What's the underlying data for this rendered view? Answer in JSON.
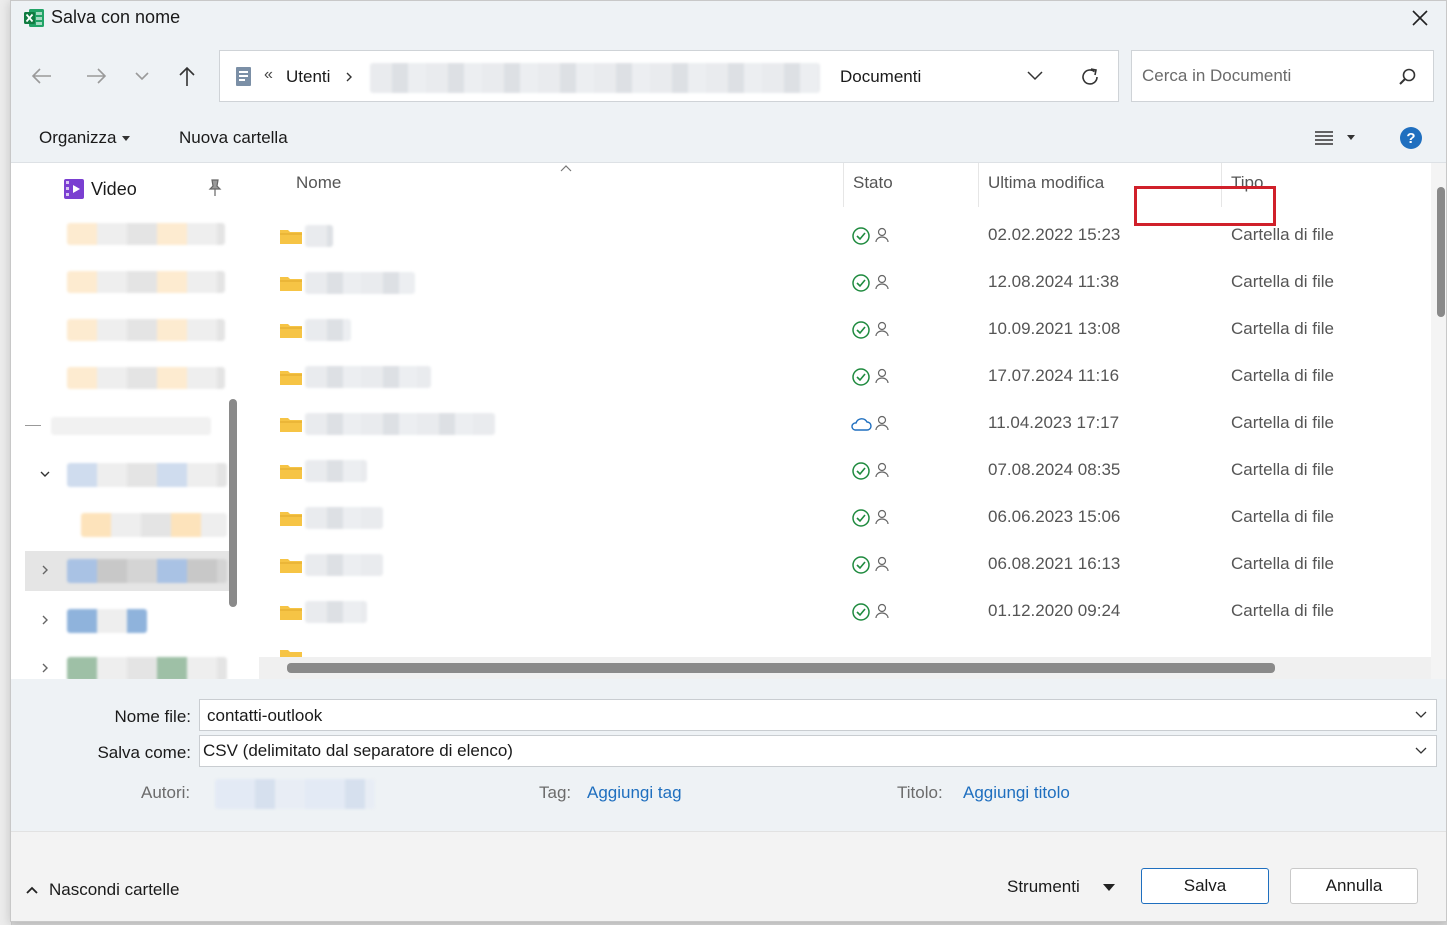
{
  "window": {
    "title": "Salva con nome"
  },
  "address": {
    "overflow": "«",
    "crumb_users": "Utenti",
    "crumb_current": "Documenti"
  },
  "search": {
    "placeholder": "Cerca in Documenti"
  },
  "toolbar": {
    "organize": "Organizza",
    "new_folder": "Nuova cartella"
  },
  "sidebar": {
    "items": [
      {
        "label": "Video"
      }
    ]
  },
  "columns": {
    "name": "Nome",
    "status": "Stato",
    "modified": "Ultima modifica",
    "type": "Tipo"
  },
  "files": [
    {
      "status": "synced",
      "modified": "02.02.2022 15:23",
      "type": "Cartella di file"
    },
    {
      "status": "synced",
      "modified": "12.08.2024 11:38",
      "type": "Cartella di file"
    },
    {
      "status": "synced",
      "modified": "10.09.2021 13:08",
      "type": "Cartella di file"
    },
    {
      "status": "synced",
      "modified": "17.07.2024 11:16",
      "type": "Cartella di file"
    },
    {
      "status": "cloud",
      "modified": "11.04.2023 17:17",
      "type": "Cartella di file"
    },
    {
      "status": "synced",
      "modified": "07.08.2024 08:35",
      "type": "Cartella di file"
    },
    {
      "status": "synced",
      "modified": "06.06.2023 15:06",
      "type": "Cartella di file"
    },
    {
      "status": "synced",
      "modified": "06.08.2021 16:13",
      "type": "Cartella di file"
    },
    {
      "status": "synced",
      "modified": "01.12.2020 09:24",
      "type": "Cartella di file"
    }
  ],
  "form": {
    "filename_label": "Nome file:",
    "filename_value": "contatti-outlook",
    "savetype_label": "Salva come:",
    "savetype_value": "CSV (delimitato dal separatore di elenco)",
    "authors_label": "Autori:",
    "tags_label": "Tag:",
    "tags_link": "Aggiungi tag",
    "title_label": "Titolo:",
    "title_link": "Aggiungi titolo"
  },
  "footer": {
    "hide_folders": "Nascondi cartelle",
    "tools": "Strumenti",
    "save": "Salva",
    "cancel": "Annulla"
  },
  "colors": {
    "accent_link": "#1f6fbf",
    "highlight_outline": "#d0202a",
    "synced_green": "#1e8a3e",
    "cloud_blue": "#1f6fbf",
    "folder_yellow": "#f6c445"
  }
}
